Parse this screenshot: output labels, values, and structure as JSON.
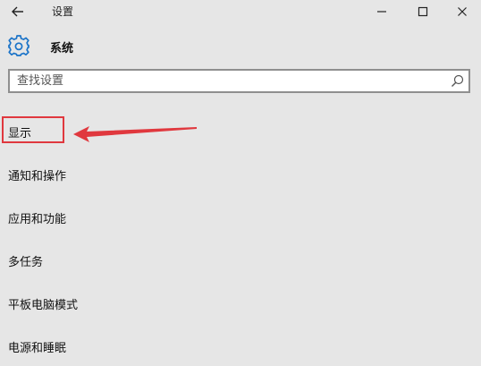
{
  "window": {
    "title": "设置",
    "back_icon": "back-arrow-icon",
    "minimize_icon": "minimize-icon",
    "maximize_icon": "maximize-icon",
    "close_icon": "close-icon"
  },
  "header": {
    "icon": "gear-icon",
    "title": "系统"
  },
  "search": {
    "placeholder": "查找设置",
    "value": "",
    "icon": "search-icon"
  },
  "nav": {
    "items": [
      {
        "label": "显示",
        "highlighted": true
      },
      {
        "label": "通知和操作",
        "highlighted": false
      },
      {
        "label": "应用和功能",
        "highlighted": false
      },
      {
        "label": "多任务",
        "highlighted": false
      },
      {
        "label": "平板电脑模式",
        "highlighted": false
      },
      {
        "label": "电源和睡眠",
        "highlighted": false
      }
    ]
  },
  "colors": {
    "background": "#e6e6e6",
    "accent": "#1a73c8",
    "annotation": "#e0383e",
    "search_border": "#8f8f8f"
  }
}
